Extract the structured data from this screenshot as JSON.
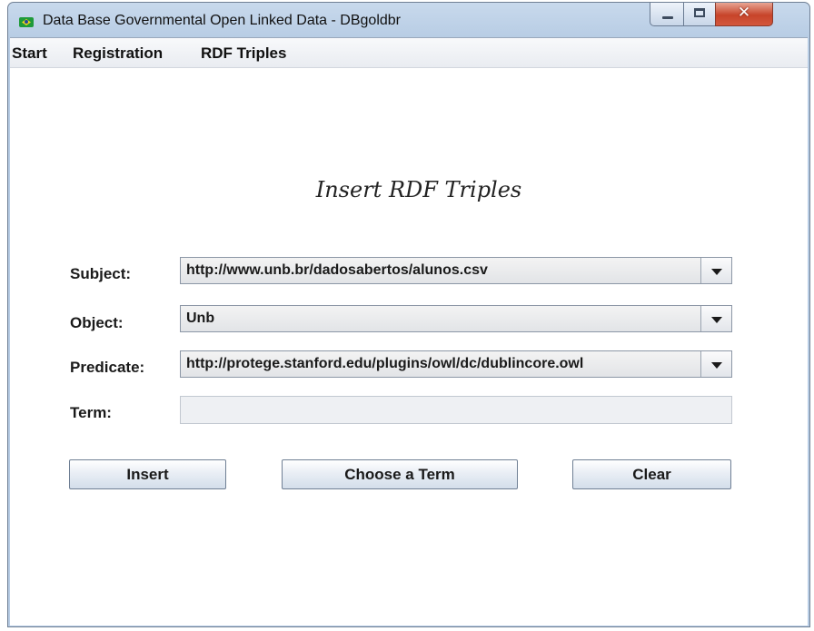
{
  "window": {
    "title": "Data Base Governmental Open Linked Data - DBgoldbr",
    "icon": "brazil-flag-icon"
  },
  "menu": {
    "items": [
      "Start",
      "Registration",
      "RDF Triples"
    ]
  },
  "form": {
    "title": "Insert RDF Triples",
    "subject": {
      "label": "Subject:",
      "value": "http://www.unb.br/dadosabertos/alunos.csv"
    },
    "object": {
      "label": "Object:",
      "value": "Unb"
    },
    "predicate": {
      "label": "Predicate:",
      "value": "http://protege.stanford.edu/plugins/owl/dc/dublincore.owl"
    },
    "term": {
      "label": "Term:",
      "value": ""
    }
  },
  "buttons": {
    "insert": "Insert",
    "choose_term": "Choose a Term",
    "clear": "Clear"
  }
}
